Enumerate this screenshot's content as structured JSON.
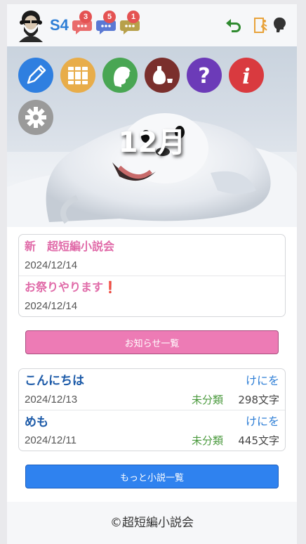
{
  "header": {
    "user_code": "S4",
    "chat_badges": [
      {
        "count": "3",
        "color": "#e96b6b",
        "icon": "chat-red-icon"
      },
      {
        "count": "5",
        "color": "#5a79d4",
        "icon": "chat-blue-icon"
      },
      {
        "count": "1",
        "color": "#b7a04a",
        "icon": "chat-olive-icon"
      }
    ],
    "right_icons": [
      "undo-arrow-icon",
      "exit-door-icon",
      "head-silhouette-icon"
    ]
  },
  "hero": {
    "month_label": "12月",
    "menu_icons": [
      {
        "icon": "pencil-icon",
        "color": "#2f7fe0"
      },
      {
        "icon": "books-icon",
        "color": "#e8ad4a"
      },
      {
        "icon": "woman-profile-icon",
        "color": "#49a653"
      },
      {
        "icon": "sake-bottle-icon",
        "color": "#7a2f2c"
      },
      {
        "icon": "question-icon",
        "color": "#6c3bb8"
      },
      {
        "icon": "info-icon",
        "color": "#d93a3f"
      },
      {
        "icon": "gear-icon",
        "color": "#9a9a9a"
      }
    ]
  },
  "news": [
    {
      "title": "新　超短編小説会",
      "date": "2024/12/14"
    },
    {
      "title": "お祭りやります❗",
      "date": "2024/12/14"
    }
  ],
  "news_button_label": "お知らせ一覧",
  "stories": [
    {
      "title": "こんにちは",
      "author": "けにを",
      "date": "2024/12/13",
      "category": "未分類",
      "chars": "298文字"
    },
    {
      "title": "めも",
      "author": "けにを",
      "date": "2024/12/11",
      "category": "未分類",
      "chars": "445文字"
    }
  ],
  "stories_button_label": "もっと小説一覧",
  "footer_text": "©超短編小説会"
}
